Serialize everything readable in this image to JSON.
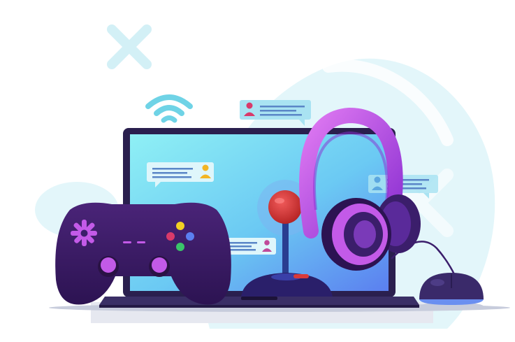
{
  "scene": {
    "kind": "illustration",
    "colors": {
      "background": "#ffffff",
      "decor": "#d9f3f7",
      "screen_top": "#7ee4f2",
      "screen_bottom": "#5a8ff0",
      "laptop_frame": "#2a1f4e",
      "gamepad": "#3b1e6b",
      "accent_purple": "#c35ae8",
      "joystick_ball": "#d93a3a",
      "chat_bubble": "#a9e3f2",
      "mouse": "#3a2a6a"
    },
    "icons": [
      "x-mark-icon",
      "wifi-icon",
      "chat-bubble-icon",
      "user-icon",
      "gamepad-icon",
      "joystick-icon",
      "headphones-icon",
      "mouse-icon",
      "laptop-icon"
    ]
  }
}
